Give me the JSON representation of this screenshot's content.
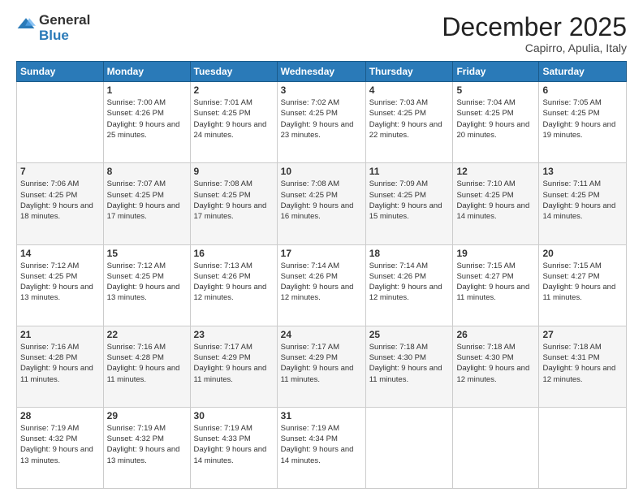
{
  "header": {
    "logo_general": "General",
    "logo_blue": "Blue",
    "month": "December 2025",
    "location": "Capirro, Apulia, Italy"
  },
  "days": [
    "Sunday",
    "Monday",
    "Tuesday",
    "Wednesday",
    "Thursday",
    "Friday",
    "Saturday"
  ],
  "weeks": [
    [
      {
        "date": "",
        "sunrise": "",
        "sunset": "",
        "daylight": ""
      },
      {
        "date": "1",
        "sunrise": "Sunrise: 7:00 AM",
        "sunset": "Sunset: 4:26 PM",
        "daylight": "Daylight: 9 hours and 25 minutes."
      },
      {
        "date": "2",
        "sunrise": "Sunrise: 7:01 AM",
        "sunset": "Sunset: 4:25 PM",
        "daylight": "Daylight: 9 hours and 24 minutes."
      },
      {
        "date": "3",
        "sunrise": "Sunrise: 7:02 AM",
        "sunset": "Sunset: 4:25 PM",
        "daylight": "Daylight: 9 hours and 23 minutes."
      },
      {
        "date": "4",
        "sunrise": "Sunrise: 7:03 AM",
        "sunset": "Sunset: 4:25 PM",
        "daylight": "Daylight: 9 hours and 22 minutes."
      },
      {
        "date": "5",
        "sunrise": "Sunrise: 7:04 AM",
        "sunset": "Sunset: 4:25 PM",
        "daylight": "Daylight: 9 hours and 20 minutes."
      },
      {
        "date": "6",
        "sunrise": "Sunrise: 7:05 AM",
        "sunset": "Sunset: 4:25 PM",
        "daylight": "Daylight: 9 hours and 19 minutes."
      }
    ],
    [
      {
        "date": "7",
        "sunrise": "Sunrise: 7:06 AM",
        "sunset": "Sunset: 4:25 PM",
        "daylight": "Daylight: 9 hours and 18 minutes."
      },
      {
        "date": "8",
        "sunrise": "Sunrise: 7:07 AM",
        "sunset": "Sunset: 4:25 PM",
        "daylight": "Daylight: 9 hours and 17 minutes."
      },
      {
        "date": "9",
        "sunrise": "Sunrise: 7:08 AM",
        "sunset": "Sunset: 4:25 PM",
        "daylight": "Daylight: 9 hours and 17 minutes."
      },
      {
        "date": "10",
        "sunrise": "Sunrise: 7:08 AM",
        "sunset": "Sunset: 4:25 PM",
        "daylight": "Daylight: 9 hours and 16 minutes."
      },
      {
        "date": "11",
        "sunrise": "Sunrise: 7:09 AM",
        "sunset": "Sunset: 4:25 PM",
        "daylight": "Daylight: 9 hours and 15 minutes."
      },
      {
        "date": "12",
        "sunrise": "Sunrise: 7:10 AM",
        "sunset": "Sunset: 4:25 PM",
        "daylight": "Daylight: 9 hours and 14 minutes."
      },
      {
        "date": "13",
        "sunrise": "Sunrise: 7:11 AM",
        "sunset": "Sunset: 4:25 PM",
        "daylight": "Daylight: 9 hours and 14 minutes."
      }
    ],
    [
      {
        "date": "14",
        "sunrise": "Sunrise: 7:12 AM",
        "sunset": "Sunset: 4:25 PM",
        "daylight": "Daylight: 9 hours and 13 minutes."
      },
      {
        "date": "15",
        "sunrise": "Sunrise: 7:12 AM",
        "sunset": "Sunset: 4:25 PM",
        "daylight": "Daylight: 9 hours and 13 minutes."
      },
      {
        "date": "16",
        "sunrise": "Sunrise: 7:13 AM",
        "sunset": "Sunset: 4:26 PM",
        "daylight": "Daylight: 9 hours and 12 minutes."
      },
      {
        "date": "17",
        "sunrise": "Sunrise: 7:14 AM",
        "sunset": "Sunset: 4:26 PM",
        "daylight": "Daylight: 9 hours and 12 minutes."
      },
      {
        "date": "18",
        "sunrise": "Sunrise: 7:14 AM",
        "sunset": "Sunset: 4:26 PM",
        "daylight": "Daylight: 9 hours and 12 minutes."
      },
      {
        "date": "19",
        "sunrise": "Sunrise: 7:15 AM",
        "sunset": "Sunset: 4:27 PM",
        "daylight": "Daylight: 9 hours and 11 minutes."
      },
      {
        "date": "20",
        "sunrise": "Sunrise: 7:15 AM",
        "sunset": "Sunset: 4:27 PM",
        "daylight": "Daylight: 9 hours and 11 minutes."
      }
    ],
    [
      {
        "date": "21",
        "sunrise": "Sunrise: 7:16 AM",
        "sunset": "Sunset: 4:28 PM",
        "daylight": "Daylight: 9 hours and 11 minutes."
      },
      {
        "date": "22",
        "sunrise": "Sunrise: 7:16 AM",
        "sunset": "Sunset: 4:28 PM",
        "daylight": "Daylight: 9 hours and 11 minutes."
      },
      {
        "date": "23",
        "sunrise": "Sunrise: 7:17 AM",
        "sunset": "Sunset: 4:29 PM",
        "daylight": "Daylight: 9 hours and 11 minutes."
      },
      {
        "date": "24",
        "sunrise": "Sunrise: 7:17 AM",
        "sunset": "Sunset: 4:29 PM",
        "daylight": "Daylight: 9 hours and 11 minutes."
      },
      {
        "date": "25",
        "sunrise": "Sunrise: 7:18 AM",
        "sunset": "Sunset: 4:30 PM",
        "daylight": "Daylight: 9 hours and 11 minutes."
      },
      {
        "date": "26",
        "sunrise": "Sunrise: 7:18 AM",
        "sunset": "Sunset: 4:30 PM",
        "daylight": "Daylight: 9 hours and 12 minutes."
      },
      {
        "date": "27",
        "sunrise": "Sunrise: 7:18 AM",
        "sunset": "Sunset: 4:31 PM",
        "daylight": "Daylight: 9 hours and 12 minutes."
      }
    ],
    [
      {
        "date": "28",
        "sunrise": "Sunrise: 7:19 AM",
        "sunset": "Sunset: 4:32 PM",
        "daylight": "Daylight: 9 hours and 13 minutes."
      },
      {
        "date": "29",
        "sunrise": "Sunrise: 7:19 AM",
        "sunset": "Sunset: 4:32 PM",
        "daylight": "Daylight: 9 hours and 13 minutes."
      },
      {
        "date": "30",
        "sunrise": "Sunrise: 7:19 AM",
        "sunset": "Sunset: 4:33 PM",
        "daylight": "Daylight: 9 hours and 14 minutes."
      },
      {
        "date": "31",
        "sunrise": "Sunrise: 7:19 AM",
        "sunset": "Sunset: 4:34 PM",
        "daylight": "Daylight: 9 hours and 14 minutes."
      },
      {
        "date": "",
        "sunrise": "",
        "sunset": "",
        "daylight": ""
      },
      {
        "date": "",
        "sunrise": "",
        "sunset": "",
        "daylight": ""
      },
      {
        "date": "",
        "sunrise": "",
        "sunset": "",
        "daylight": ""
      }
    ]
  ]
}
